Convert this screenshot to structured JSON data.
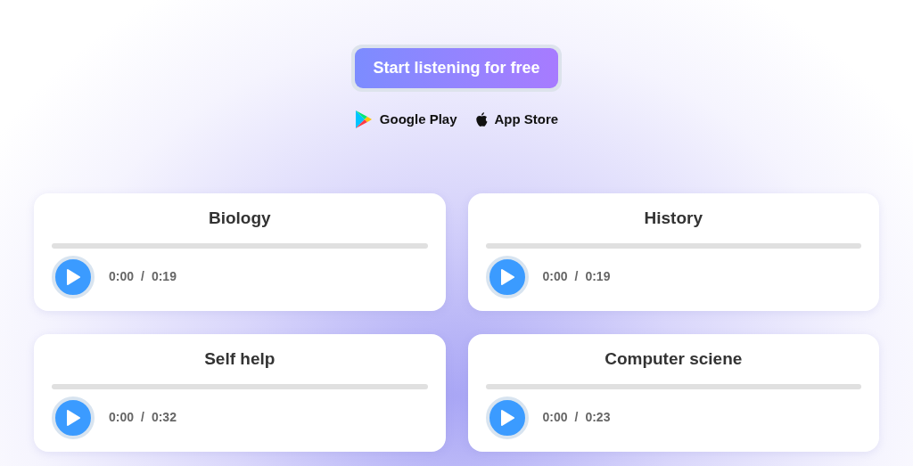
{
  "cta": {
    "label": "Start listening for free"
  },
  "stores": [
    {
      "kind": "google",
      "label": "Google Play"
    },
    {
      "kind": "apple",
      "label": "App Store"
    }
  ],
  "players": [
    {
      "title": "Biology",
      "level": 0,
      "current": "0:00",
      "separator": "/",
      "duration": "0:19"
    },
    {
      "title": "History",
      "level": 0,
      "current": "0:00",
      "separator": "/",
      "duration": "0:19"
    },
    {
      "title": "Self help",
      "level": 0,
      "current": "0:00",
      "separator": "/",
      "duration": "0:32"
    },
    {
      "title": "Computer sciene",
      "level": 0,
      "current": "0:00",
      "separator": "/",
      "duration": "0:23"
    }
  ]
}
